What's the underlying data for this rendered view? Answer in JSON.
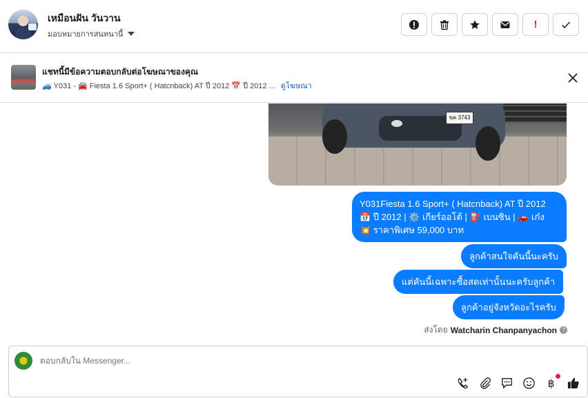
{
  "header": {
    "contact_name": "เหมือนฝัน วันวาน",
    "assign_label": "มอบหมายการสนทนานี้",
    "actions": [
      {
        "name": "report-icon",
        "label": ""
      },
      {
        "name": "trash-icon",
        "label": ""
      },
      {
        "name": "star-icon",
        "label": ""
      },
      {
        "name": "mail-icon",
        "label": ""
      },
      {
        "name": "exclamation-icon",
        "label": "!"
      },
      {
        "name": "check-icon",
        "label": ""
      }
    ]
  },
  "ad_banner": {
    "title": "แชทนี้มีข้อความตอบกลับต่อโฆษณาของคุณ",
    "subtitle": "🚙 Y031 - 🚘 Fiesta 1.6 Sport+ ( Hatcnback) AT ปี 2012 📅 ปี 2012 ...",
    "link": "ดูโฆษณา"
  },
  "car_photo": {
    "plate": "ขค 3743"
  },
  "messages": [
    {
      "text": "Y031Fiesta 1.6 Sport+ ( Hatcnback) AT ปี 2012\n📅 ปี 2012 | ⚙️ เกียร์ออโต้ | ⛽ เบนซิน | 🚗 เก๋ง\n💥 ราคาพิเศษ 59,000 บาท"
    },
    {
      "text": "ลูกค้าสนใจคันนี้นะครับ"
    },
    {
      "text": "แต่คันนี้เฉพาะซื้อสดเท่านั้นนะครับลูกค้า"
    },
    {
      "text": "ลูกค้าอยู่จังหวัดอะไรครับ"
    }
  ],
  "sent_by": {
    "prefix": "ส่งโดย",
    "name": "Watcharin Chanpanyachon"
  },
  "composer": {
    "placeholder": "ตอบกลับใน Messenger..."
  },
  "colors": {
    "bubble": "#0a7cff",
    "alert": "#e41e3f",
    "link": "#1a5fb4"
  }
}
